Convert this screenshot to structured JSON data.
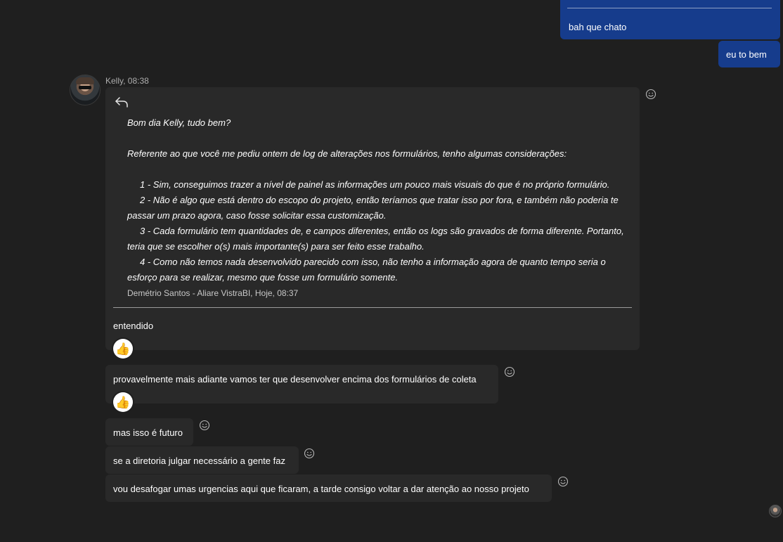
{
  "own_messages": [
    {
      "text": "bah que chato"
    },
    {
      "text": "eu to bem"
    }
  ],
  "incoming": {
    "sender_time": "Kelly, 08:38",
    "main_message": {
      "quote": {
        "greeting": "Bom dia Kelly, tudo bem?",
        "intro": "Referente ao que você me pediu ontem de log de alterações nos formulários, tenho algumas considerações:",
        "item1": "1 - Sim, conseguimos trazer a nível de painel as informações um pouco mais visuais do que é no próprio formulário.",
        "item2": "2 - Não é algo que está dentro do escopo do projeto, então teríamos que tratar isso por fora, e também não poderia te passar um prazo agora, caso fosse solicitar essa customização.",
        "item3": "3 - Cada formulário tem quantidades de, e campos diferentes, então os logs são gravados de forma diferente. Portanto, teria que se escolher o(s) mais importante(s) para ser feito esse trabalho.",
        "item4": "4 - Como não temos nada desenvolvido parecido com isso, não tenho a informação agora de quanto tempo seria o esforço para se realizar, mesmo que fosse um formulário somente.",
        "meta": "Demétrio Santos - Aliare VistraBI, Hoje, 08:37"
      },
      "text": "entendido",
      "reaction": "👍"
    },
    "messages": [
      {
        "text": "provavelmente mais adiante vamos ter que desenvolver encima dos formulários de coleta",
        "reaction": "👍"
      },
      {
        "text": "mas isso é futuro"
      },
      {
        "text": "se a diretoria julgar necessário a gente faz"
      },
      {
        "text": "vou desafogar umas urgencias aqui que ficaram, a tarde consigo voltar a dar atenção ao nosso projeto"
      }
    ]
  },
  "icons": {
    "reply": "reply-arrow-icon",
    "emoji": "smiley-icon",
    "reaction": "thumbs-up"
  },
  "colors": {
    "background": "#1f1f1f",
    "own_bubble": "#163c8c",
    "incoming_bubble": "#292929"
  }
}
